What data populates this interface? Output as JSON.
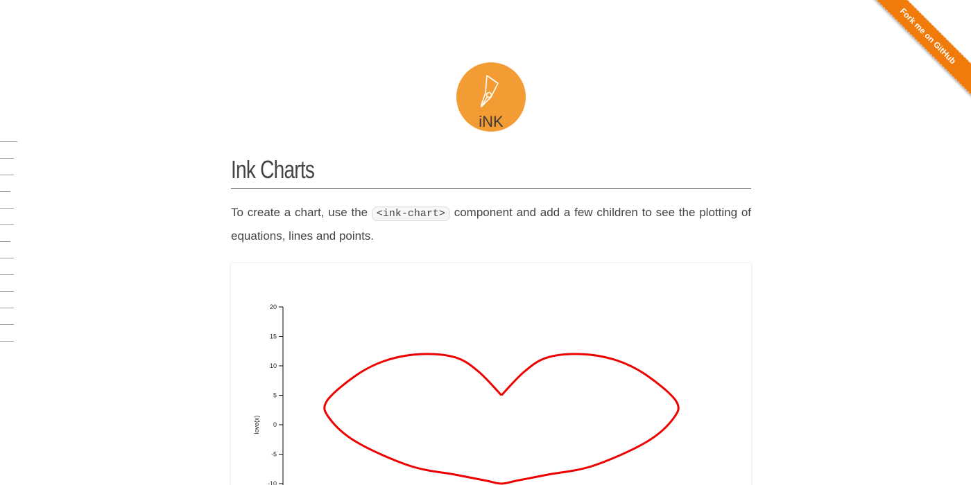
{
  "ribbon": {
    "label": "Fork me on GitHub",
    "color": "#f07a0a"
  },
  "logo": {
    "text": "iNK",
    "background": "#f39c34"
  },
  "page": {
    "title": "Ink Charts",
    "intro_before": "To create a chart, use the ",
    "intro_code": "<ink-chart>",
    "intro_after": " component and add a few children to see the plotting of equations, lines and points."
  },
  "side_nav": {
    "item_count": 13
  },
  "chart_data": {
    "type": "line",
    "ylabel": "love(x)",
    "xlabel": "",
    "y_ticks": [
      20,
      15,
      10,
      5,
      0,
      -5,
      -10
    ],
    "ylim": [
      -10,
      20
    ],
    "series": [
      {
        "color": "#ee0000",
        "points": [
          [
            0,
            5
          ],
          [
            1.5,
            9
          ],
          [
            3,
            11.4
          ],
          [
            5.2,
            12
          ],
          [
            7.5,
            11
          ],
          [
            9.5,
            8.5
          ],
          [
            11.5,
            4
          ],
          [
            11.3,
            1
          ],
          [
            9.5,
            -3
          ],
          [
            6,
            -7
          ],
          [
            3,
            -8.5
          ],
          [
            1,
            -9.5
          ],
          [
            0,
            -10
          ],
          [
            -1,
            -9.5
          ],
          [
            -3,
            -8.5
          ],
          [
            -6,
            -7
          ],
          [
            -9.5,
            -3
          ],
          [
            -11.3,
            1
          ],
          [
            -11.5,
            4
          ],
          [
            -9.5,
            8.5
          ],
          [
            -7.5,
            11
          ],
          [
            -5.2,
            12
          ],
          [
            -3,
            11.4
          ],
          [
            -1.5,
            9
          ],
          [
            0,
            5
          ]
        ]
      }
    ]
  }
}
